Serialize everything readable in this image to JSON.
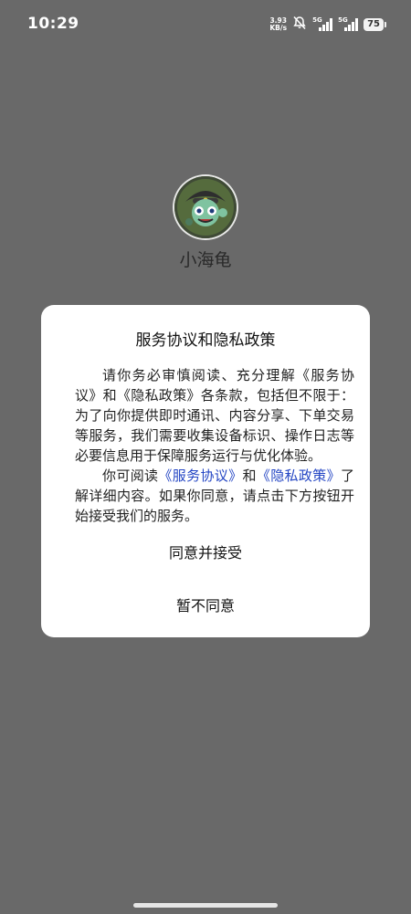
{
  "status_bar": {
    "time": "10:29",
    "net_speed_value": "3.93",
    "net_speed_unit": "KB/s",
    "signal1_label": "5G",
    "signal2_label": "5G",
    "battery": "75"
  },
  "app": {
    "name": "小海龟"
  },
  "dialog": {
    "title": "服务协议和隐私政策",
    "para1": "请你务必审慎阅读、充分理解《服务协议》和《隐私政策》各条款，包括但不限于：为了向你提供即时通讯、内容分享、下单交易等服务，我们需要收集设备标识、操作日志等必要信息用于保障服务运行与优化体验。",
    "para2_prefix": "你可阅读",
    "link_service": "《服务协议》",
    "para2_and": "和",
    "link_privacy": "《隐私政策》",
    "para2_suffix": "了解详细内容。如果你同意，请点击下方按钮开始接受我们的服务。",
    "accept_label": "同意并接受",
    "decline_label": "暂不同意"
  },
  "colors": {
    "overlay_background": "#696969",
    "link": "#2446c4",
    "dialog_background": "#ffffff"
  },
  "icons": {
    "mute": "bell-slash-icon",
    "signal": "signal-bars-icon",
    "avatar": "turtle-avatar"
  }
}
